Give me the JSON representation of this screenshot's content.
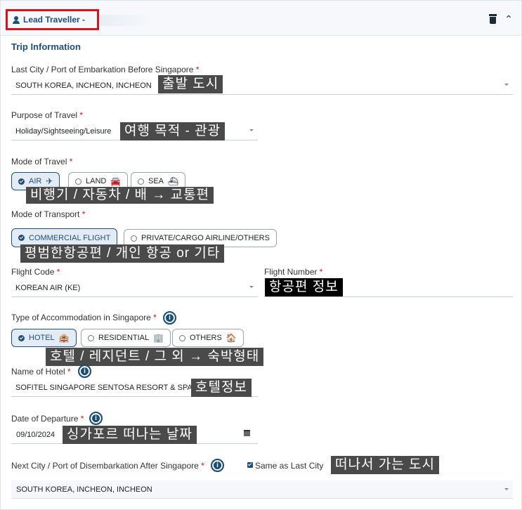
{
  "header": {
    "title": "Lead Traveller -",
    "trash_icon": "trash-icon",
    "collapse_icon": "chevron-up-icon"
  },
  "section_title": "Trip Information",
  "last_city": {
    "label": "Last City / Port of Embarkation Before Singapore",
    "required": "*",
    "value": "SOUTH KOREA, INCHEON, INCHEON",
    "annotation": "출발 도시"
  },
  "purpose": {
    "label": "Purpose of Travel",
    "required": "*",
    "value": "Holiday/Sightseeing/Leisure",
    "annotation": "여행 목적 - 관광"
  },
  "mode_of_travel": {
    "label": "Mode of Travel",
    "required": "*",
    "options": [
      {
        "label": "AIR",
        "icon": "airplane-icon",
        "glyph": "✈",
        "selected": true
      },
      {
        "label": "LAND",
        "icon": "car-icon",
        "glyph": "🚘",
        "selected": false
      },
      {
        "label": "SEA",
        "icon": "ship-icon",
        "glyph": "⛴",
        "selected": false
      }
    ],
    "annotation": "비행기 / 자동차 / 배       → 교통편"
  },
  "mode_of_transport": {
    "label": "Mode of Transport",
    "required": "*",
    "options": [
      {
        "label": "COMMERCIAL FLIGHT",
        "selected": true
      },
      {
        "label": "PRIVATE/CARGO AIRLINE/OTHERS",
        "selected": false
      }
    ],
    "annotation": "평범한항공편 / 개인 항공 or 기타"
  },
  "flight_code": {
    "label": "Flight Code",
    "required": "*",
    "value": "KOREAN AIR (KE)"
  },
  "flight_number": {
    "label": "Flight Number",
    "required": "*",
    "annotation": "항공편 정보"
  },
  "accommodation": {
    "label": "Type of Accommodation in Singapore",
    "required": "*",
    "options": [
      {
        "label": "HOTEL",
        "icon": "hotel-icon",
        "glyph": "🏨",
        "selected": true
      },
      {
        "label": "RESIDENTIAL",
        "icon": "residential-icon",
        "glyph": "🏢",
        "selected": false
      },
      {
        "label": "OTHERS",
        "icon": "home-icon",
        "glyph": "🏠",
        "selected": false
      }
    ],
    "annotation": "호텔 / 레지던트  / 그 외      → 숙박형태"
  },
  "hotel_name": {
    "label": "Name of Hotel",
    "required": "*",
    "value": "SOFITEL SINGAPORE SENTOSA RESORT & SPA",
    "annotation": "호텔정보"
  },
  "departure_date": {
    "label": "Date of Departure",
    "required": "*",
    "value": "09/10/2024",
    "annotation": "싱가포르 떠나는 날짜"
  },
  "next_city": {
    "label": "Next City / Port of Disembarkation After Singapore",
    "required": "*",
    "checkbox_label": "Same as Last City",
    "checked": true,
    "value": "SOUTH KOREA, INCHEON, INCHEON",
    "annotation": "떠나서 가는 도시"
  },
  "info_glyph": "i"
}
